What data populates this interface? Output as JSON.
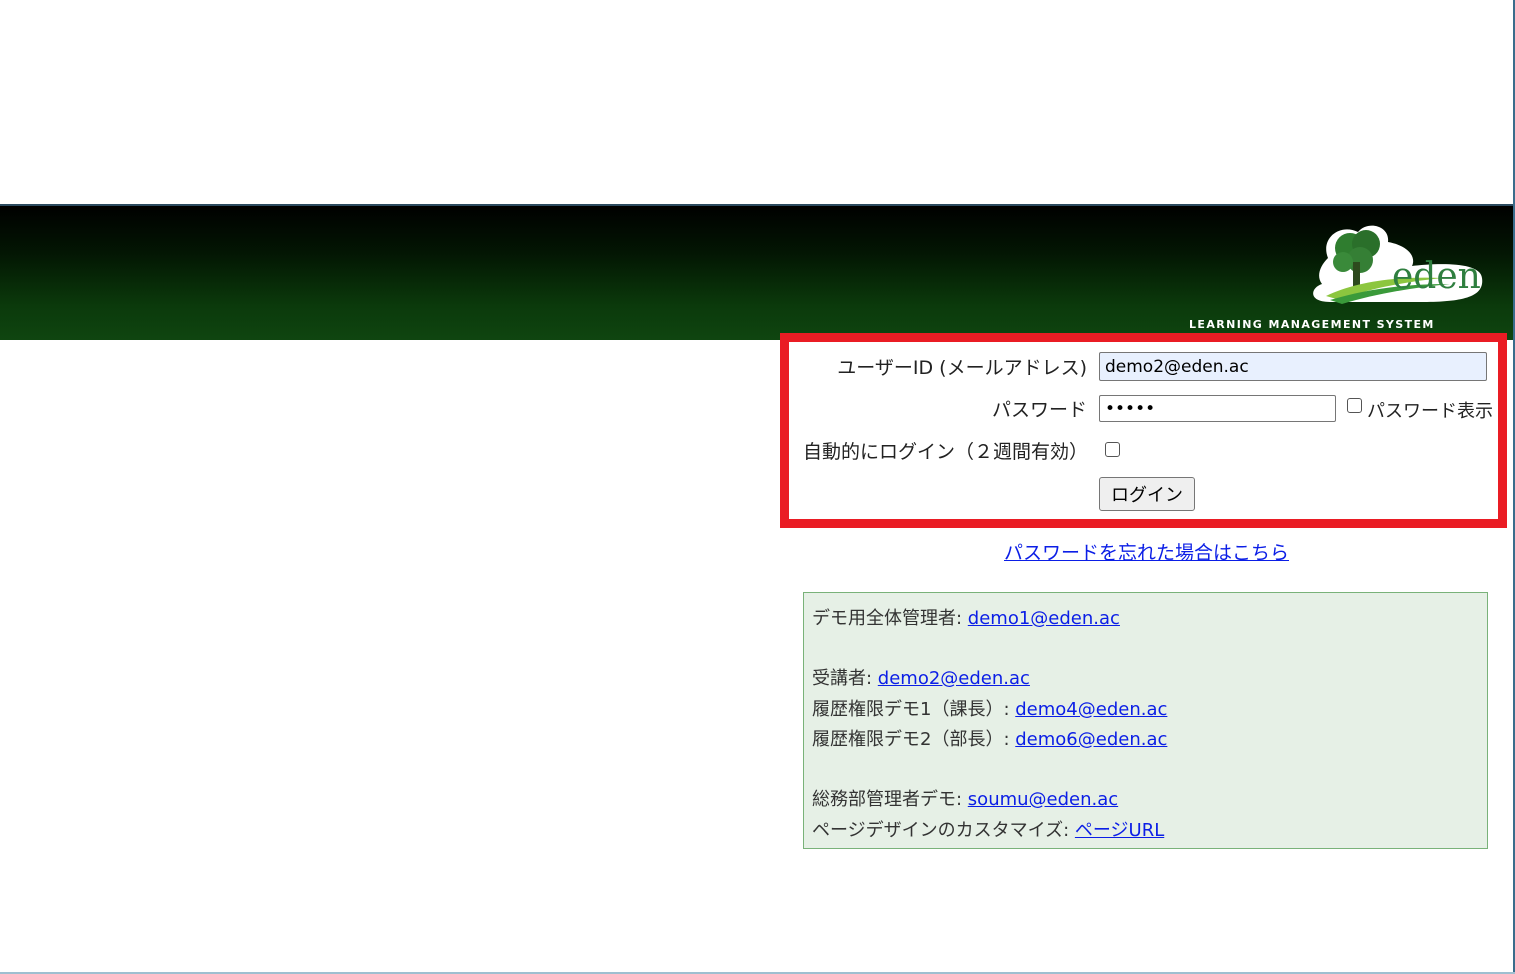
{
  "banner": {
    "logo_text": "eden",
    "tagline": "LEARNING MANAGEMENT SYSTEM"
  },
  "login": {
    "userid_label": "ユーザーID (メールアドレス)",
    "userid_value": "demo2@eden.ac",
    "password_label": "パスワード",
    "password_value": "•••••",
    "show_password_label": "パスワード表示",
    "auto_login_label": "自動的にログイン（２週間有効）",
    "login_button": "ログイン"
  },
  "forgot_link": "パスワードを忘れた場合はこちら",
  "demo_accounts": {
    "admin": {
      "label": "デモ用全体管理者: ",
      "email": "demo1@eden.ac"
    },
    "student": {
      "label": "受講者: ",
      "email": "demo2@eden.ac"
    },
    "history1": {
      "label": "履歴権限デモ1（課長）: ",
      "email": "demo4@eden.ac"
    },
    "history2": {
      "label": "履歴権限デモ2（部長）: ",
      "email": "demo6@eden.ac"
    },
    "soumu": {
      "label": "総務部管理者デモ: ",
      "email": "soumu@eden.ac"
    },
    "page_design": {
      "label": "ページデザインのカスタマイズ: ",
      "link": "ページURL"
    }
  },
  "colors": {
    "highlight_border": "#ea1c24",
    "link": "#0b1ee6",
    "demo_bg": "#e6f0e6"
  }
}
